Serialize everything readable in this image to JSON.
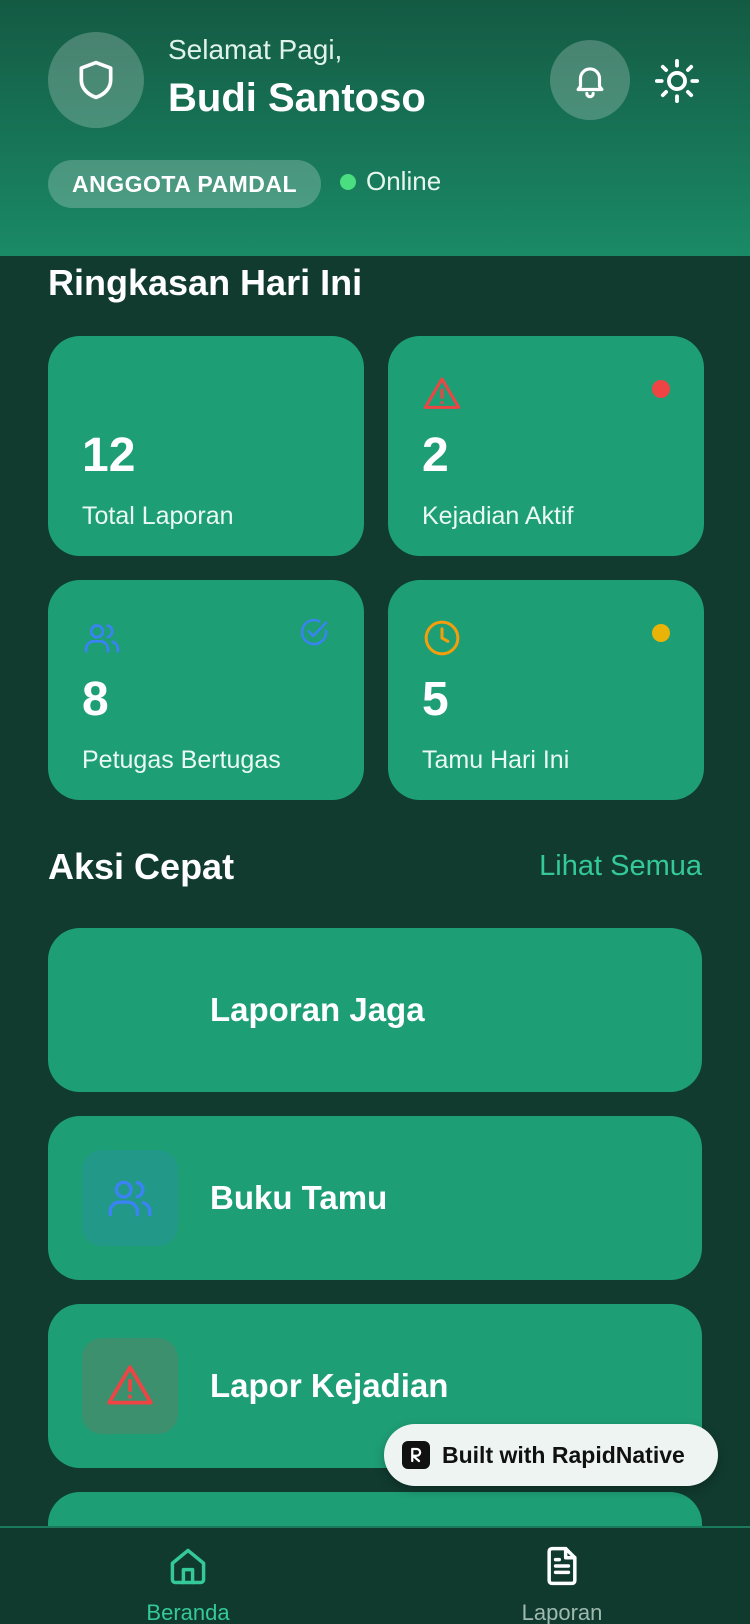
{
  "header": {
    "greeting": "Selamat Pagi,",
    "user_name": "Budi Santoso",
    "role_badge": "ANGGOTA PAMDAL",
    "status_text": "Online"
  },
  "summary": {
    "title": "Ringkasan Hari Ini",
    "cards": [
      {
        "value": "12",
        "label": "Total Laporan",
        "icon": "file-icon"
      },
      {
        "value": "2",
        "label": "Kejadian Aktif",
        "icon": "warning-icon",
        "indicator_color": "#ef4444"
      },
      {
        "value": "8",
        "label": "Petugas Bertugas",
        "icon": "users-icon",
        "indicator": "check-circle-icon"
      },
      {
        "value": "5",
        "label": "Tamu Hari Ini",
        "icon": "clock-icon",
        "indicator_color": "#eab308"
      }
    ]
  },
  "quick_actions": {
    "title": "Aksi Cepat",
    "see_all": "Lihat Semua",
    "items": [
      {
        "title": "Laporan Jaga",
        "icon": "document-icon"
      },
      {
        "title": "Buku Tamu",
        "icon": "users-icon"
      },
      {
        "title": "Lapor Kejadian",
        "icon": "warning-icon"
      }
    ]
  },
  "branding": {
    "built_with": "Built with RapidNative"
  },
  "nav": {
    "items": [
      {
        "label": "Beranda",
        "icon": "home-icon",
        "active": true
      },
      {
        "label": "Laporan",
        "icon": "document-icon",
        "active": false
      }
    ]
  },
  "colors": {
    "accent": "#34c89a",
    "card": "#1e9e75",
    "background": "#113b2f",
    "danger": "#ef4444",
    "warning": "#eab308",
    "info": "#3b82f6",
    "orange": "#f59e0b",
    "online": "#4ade80"
  }
}
